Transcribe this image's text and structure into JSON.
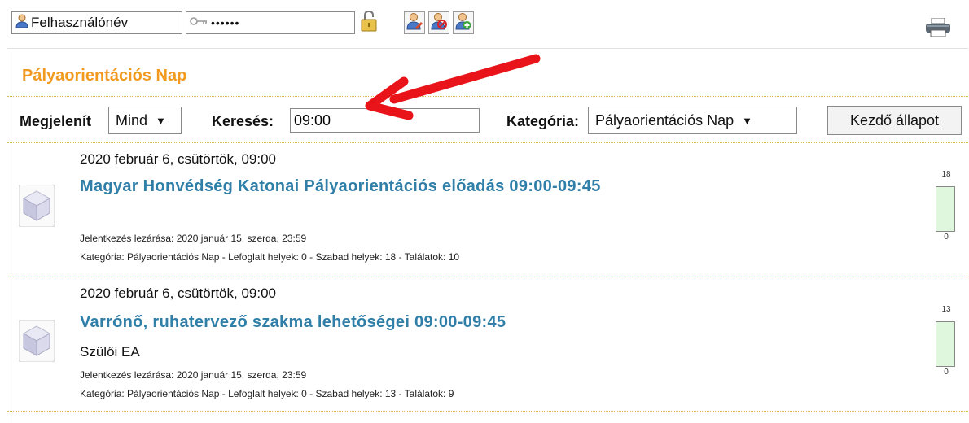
{
  "login": {
    "username_placeholder": "Felhasználónév",
    "password_value": "••••••"
  },
  "icons": {
    "user": "user-icon",
    "key": "key-icon",
    "lock": "padlock-open-icon",
    "user_edit": "user-edit-icon",
    "user_remove": "user-remove-icon",
    "user_add": "user-add-icon",
    "printer": "printer-icon",
    "event": "cube-icon"
  },
  "section": {
    "title": "Pályaorientációs Nap"
  },
  "filters": {
    "display_label": "Megjelenít",
    "display_value": "Mind",
    "search_label": "Keresés:",
    "search_value": "09:00",
    "category_label": "Kategória:",
    "category_value": "Pályaorientációs Nap",
    "reset_label": "Kezdő állapot"
  },
  "events": [
    {
      "date": "2020 február 6, csütörtök, 09:00",
      "title": "Magyar Honvédség Katonai Pályaorientációs előadás 09:00-09:45",
      "subtitle": "",
      "deadline": "Jelentkezés lezárása: 2020 január 15, szerda, 23:59",
      "details": "Kategória: Pályaorientációs Nap - Lefoglalt helyek: 0 - Szabad helyek: 18 - Találatok: 10",
      "gauge_max": "18",
      "gauge_min": "0",
      "gauge_fill": 0
    },
    {
      "date": "2020 február 6, csütörtök, 09:00",
      "title": "Varrónő, ruhatervező szakma lehetőségei 09:00-09:45",
      "subtitle": "Szülői EA",
      "deadline": "Jelentkezés lezárása: 2020 január 15, szerda, 23:59",
      "details": "Kategória: Pályaorientációs Nap - Lefoglalt helyek: 0 - Szabad helyek: 13 - Találatok: 9",
      "gauge_max": "13",
      "gauge_min": "0",
      "gauge_fill": 0
    }
  ],
  "colors": {
    "title_orange": "#f29a1f",
    "link_blue": "#2f7fa8",
    "annotation_red": "#e8141a",
    "gauge_green": "#dff7dc"
  }
}
